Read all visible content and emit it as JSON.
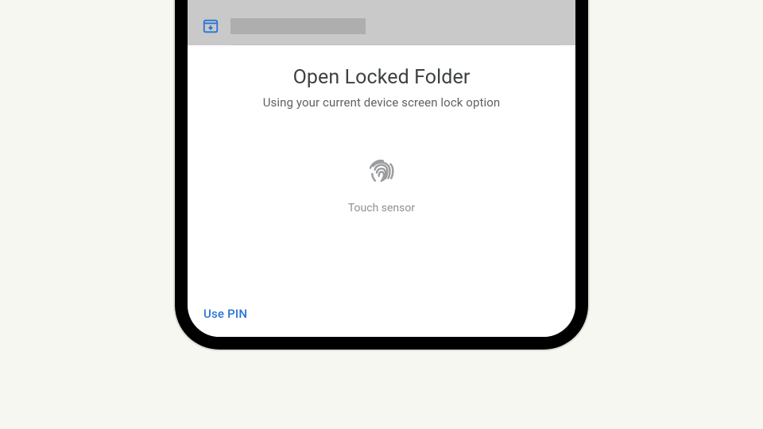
{
  "header": {
    "archive_icon": "archive-download-icon"
  },
  "panel": {
    "title": "Open Locked Folder",
    "subtitle": "Using your current device screen lock option",
    "fingerprint_label": "Touch sensor",
    "use_pin_label": "Use PIN"
  },
  "colors": {
    "accent_blue": "#2974d6"
  }
}
